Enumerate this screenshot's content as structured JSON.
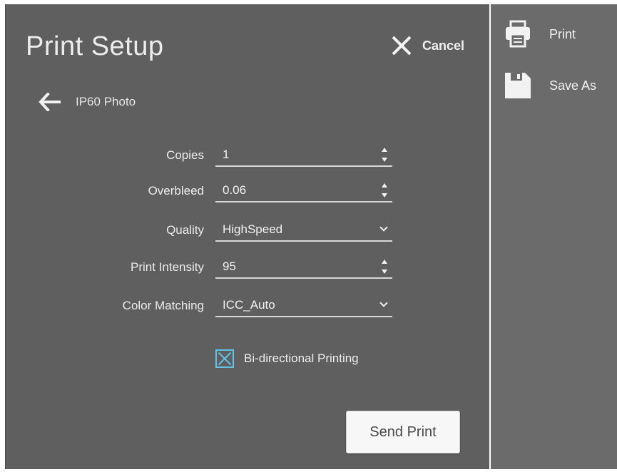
{
  "dialog": {
    "title": "Print Setup",
    "cancel_label": "Cancel",
    "printer_name": "IP60 Photo"
  },
  "form": {
    "copies": {
      "label": "Copies",
      "value": "1"
    },
    "overbleed": {
      "label": "Overbleed",
      "value": "0.06"
    },
    "quality": {
      "label": "Quality",
      "value": "HighSpeed"
    },
    "print_intensity": {
      "label": "Print Intensity",
      "value": "95"
    },
    "color_matching": {
      "label": "Color Matching",
      "value": "ICC_Auto"
    },
    "bidirectional": {
      "label": "Bi-directional Printing",
      "checked": true
    }
  },
  "send_print_label": "Send Print",
  "sidebar": {
    "items": [
      {
        "label": "Print",
        "icon": "printer-icon"
      },
      {
        "label": "Save As",
        "icon": "save-icon"
      }
    ]
  },
  "colors": {
    "panel": "#5f5f5f",
    "sidebar": "#6b6b6b",
    "accent": "#5fc4e8"
  }
}
